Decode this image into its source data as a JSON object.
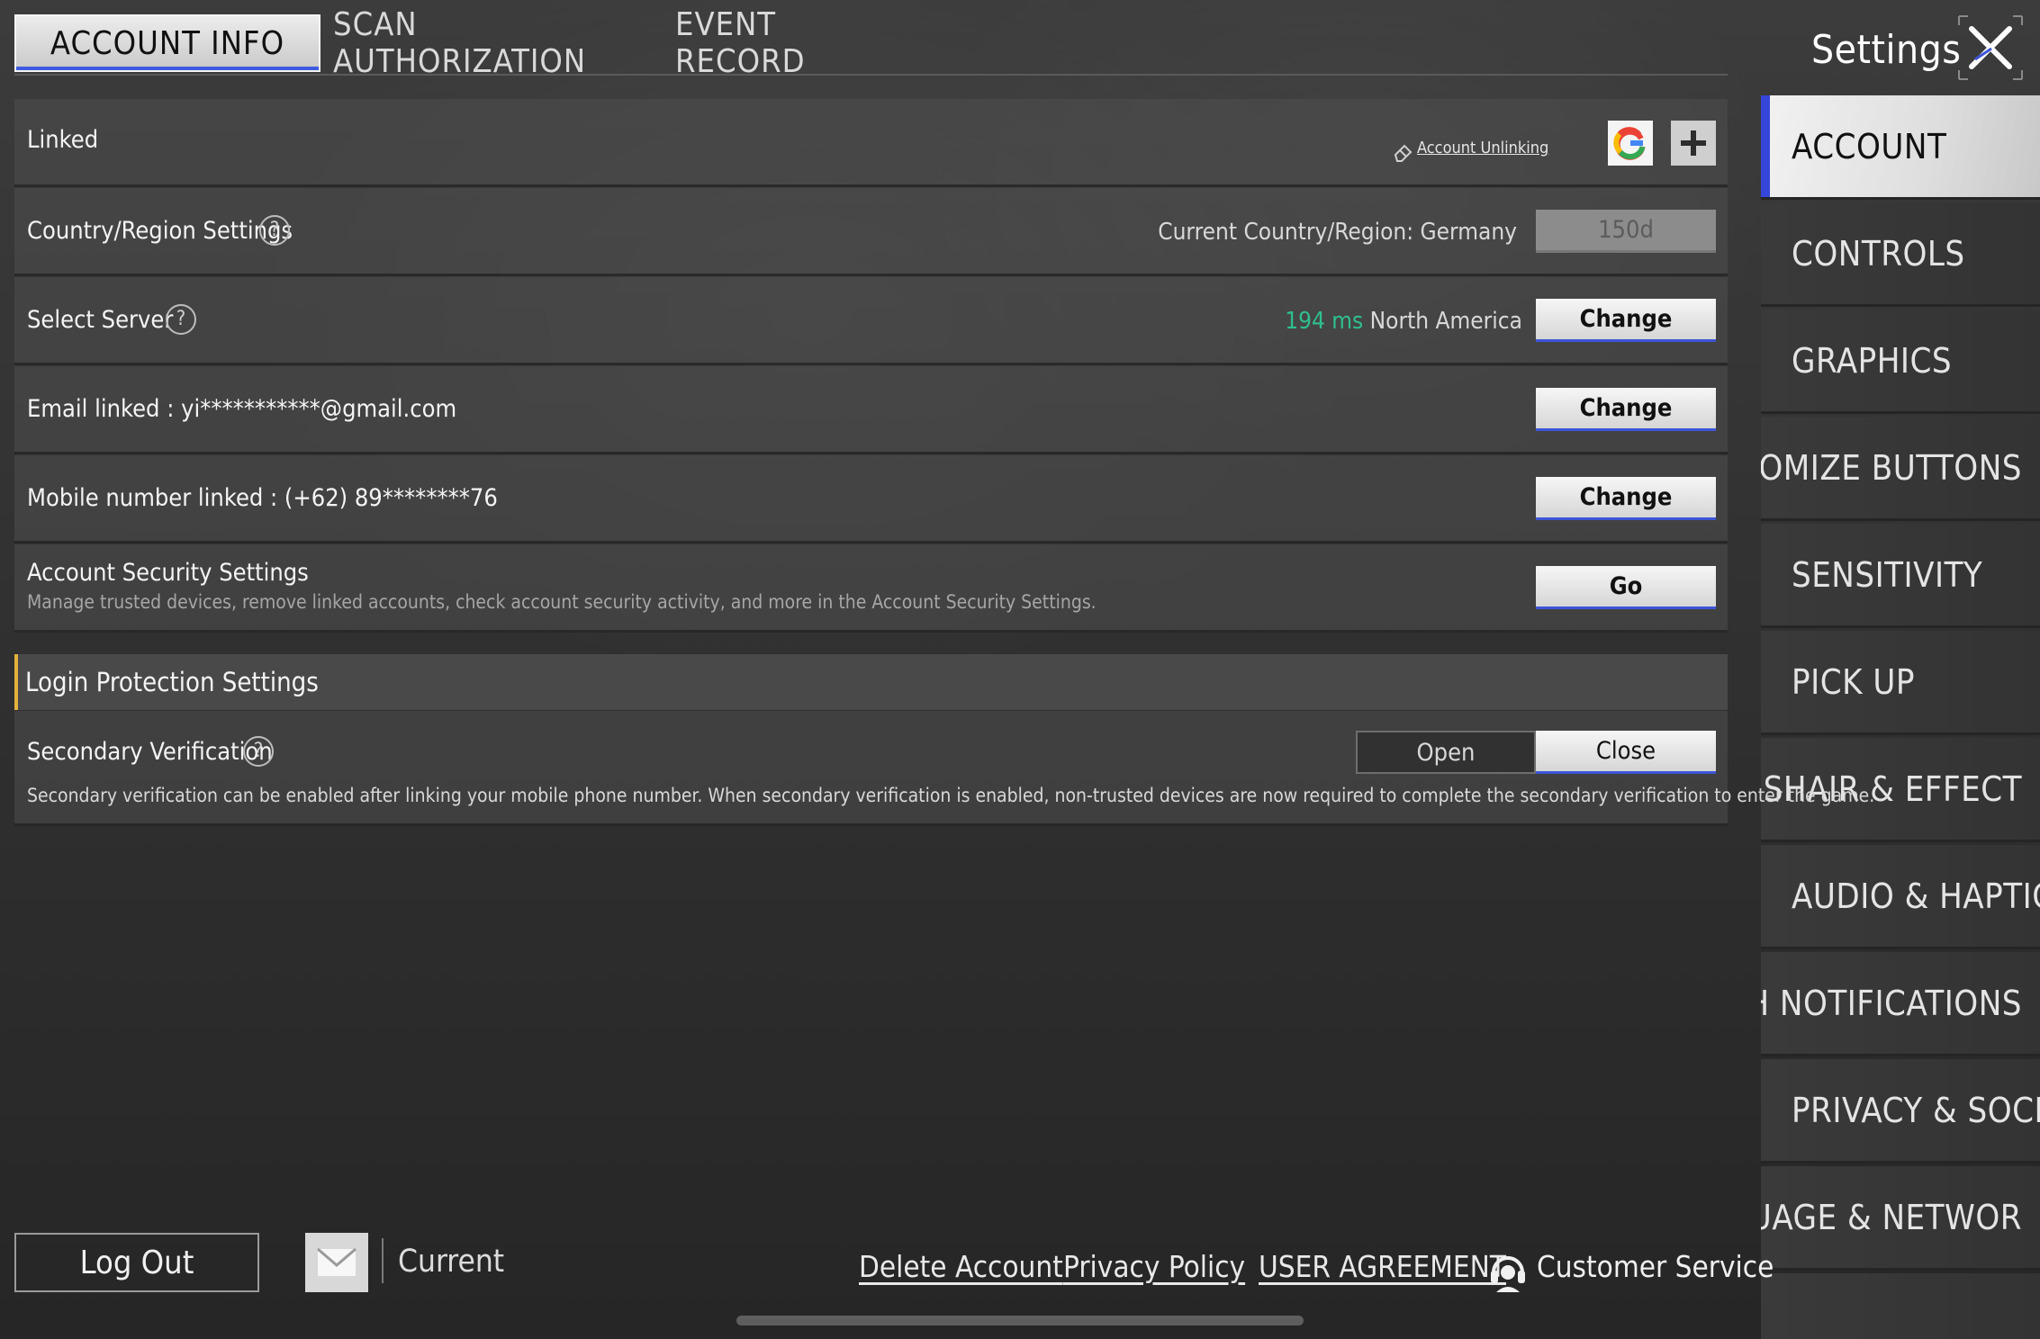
{
  "tabs": [
    {
      "label": "ACCOUNT INFO",
      "active": true
    },
    {
      "label": "SCAN AUTHORIZATION",
      "active": false
    },
    {
      "label": "EVENT RECORD",
      "active": false
    }
  ],
  "header": {
    "title": "Settings",
    "close_icon": "close-x-icon"
  },
  "sidebar": {
    "items": [
      {
        "label": "ACCOUNT",
        "active": true
      },
      {
        "label": "CONTROLS",
        "active": false
      },
      {
        "label": "GRAPHICS",
        "active": false
      },
      {
        "label": "ISTOMIZE BUTTONS",
        "active": false
      },
      {
        "label": "SENSITIVITY",
        "active": false
      },
      {
        "label": "PICK UP",
        "active": false
      },
      {
        "label": "ROSSHAIR & EFFECT",
        "active": false
      },
      {
        "label": "AUDIO & HAPTICS",
        "active": false
      },
      {
        "label": "ISH NOTIFICATIONS",
        "active": false
      },
      {
        "label": "PRIVACY & SOCIAL",
        "active": false
      },
      {
        "label": "NGUAGE & NETWOR",
        "active": false
      }
    ]
  },
  "linked": {
    "label": "Linked",
    "unlinking_label": "Account Unlinking",
    "unlinking_icon": "eraser-icon",
    "google_icon": "google-logo-icon",
    "add_icon": "plus-icon"
  },
  "country": {
    "label": "Country/Region Settings",
    "help_icon": "?",
    "current": "Current Country/Region: Germany",
    "button": "150d"
  },
  "server": {
    "label": "Select Server",
    "help_icon": "?",
    "ping": "194 ms",
    "ping_color": "#2fbf8f",
    "region": "North America",
    "button": "Change"
  },
  "email": {
    "label": "Email linked : yi***********@gmail.com",
    "button": "Change"
  },
  "mobile": {
    "label": "Mobile number linked : (+62) 89********76",
    "button": "Change"
  },
  "security": {
    "label": "Account Security Settings",
    "description": "Manage trusted devices, remove linked accounts, check account security activity, and more in the Account Security Settings.",
    "button": "Go"
  },
  "login_protection": {
    "title": "Login Protection Settings",
    "accent_color": "#e2b23a"
  },
  "secondary": {
    "label": "Secondary Verification",
    "help_icon": "?",
    "description": "Secondary verification can be enabled after linking your mobile phone number. When secondary verification is enabled, non-trusted devices are now required to complete the secondary verification to enter the game.",
    "options": [
      {
        "label": "Open",
        "selected": false
      },
      {
        "label": "Close",
        "selected": true
      }
    ]
  },
  "footer": {
    "logout": "Log Out",
    "mail_icon": "envelope-icon",
    "current": "Current",
    "links": [
      "Delete Account",
      "Privacy Policy",
      "USER AGREEMENT"
    ],
    "customer_service": "Customer Service",
    "customer_service_icon": "headset-icon"
  },
  "colors": {
    "accent_blue": "#3546d9",
    "ping_green": "#2fbf8f",
    "section_gold": "#e2b23a"
  }
}
